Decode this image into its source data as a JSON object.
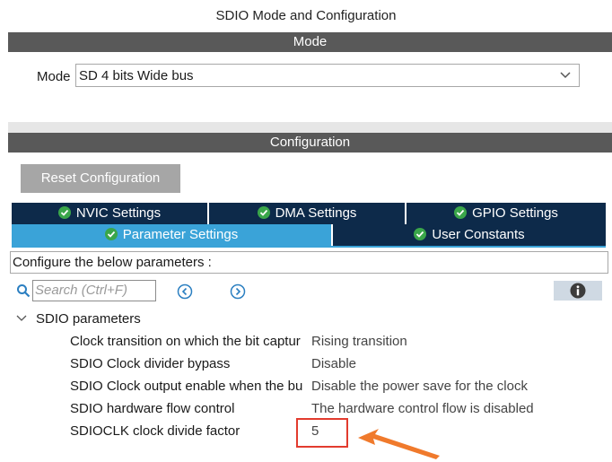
{
  "window": {
    "title": "SDIO Mode and Configuration"
  },
  "mode_section": {
    "header": "Mode",
    "label": "Mode",
    "selected": "SD 4 bits Wide bus"
  },
  "config_section": {
    "header": "Configuration",
    "reset_label": "Reset Configuration",
    "tabs_row1": [
      "NVIC Settings",
      "DMA Settings",
      "GPIO Settings"
    ],
    "tabs_row2": [
      "Parameter Settings",
      "User Constants"
    ],
    "active_tab": "Parameter Settings",
    "configure_text": "Configure the below parameters :",
    "search_placeholder": "Search (Ctrl+F)",
    "group_label": "SDIO parameters",
    "params": [
      {
        "name": "Clock transition on which the bit captur",
        "value": "Rising transition"
      },
      {
        "name": "SDIO Clock divider bypass",
        "value": "Disable"
      },
      {
        "name": "SDIO Clock output enable when the bu",
        "value": "Disable the power save for the clock"
      },
      {
        "name": "SDIO hardware flow control",
        "value": "The hardware control flow is disabled"
      },
      {
        "name": "SDIOCLK clock divide factor",
        "value": "5"
      }
    ]
  },
  "colors": {
    "header_bar": "#595959",
    "tab_dark": "#0d2a4a",
    "tab_active": "#3aa3d8",
    "check_green": "#3aa64a",
    "highlight_red": "#e23b2e",
    "arrow_orange": "#f07a2c"
  },
  "icons": [
    "chevron-down-icon",
    "check-icon",
    "search-icon",
    "nav-prev-icon",
    "nav-next-icon",
    "info-icon",
    "expand-chevron-icon"
  ]
}
